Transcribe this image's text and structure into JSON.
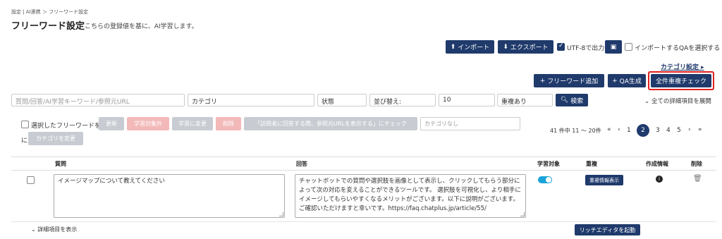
{
  "header": {
    "breadcrumb": "設定 | AI連携 ＞ フリーワード設定",
    "title": "フリーワード設定",
    "subtitle": "こちらの登録値を基に、AI学習します。"
  },
  "toolbar": {
    "import": "インポート",
    "export": "エクスポート",
    "utf8": "UTF-8で出力",
    "select_import_qa": "インポートするQAを選択する",
    "category_settings": "カテゴリ設定",
    "add_freeword": "フリーワード追加",
    "qa_generate": "QA生成",
    "dup_check": "全件重複チェック"
  },
  "filters": {
    "question_placeholder": "質問/回答/AI学習キーワード/参照元URL",
    "category": "カテゴリ",
    "status": "状態",
    "sort": "並び替え:",
    "per_page": "10",
    "duplicate": "重複あり",
    "search": "検索",
    "expand_all": "全ての詳細項目を展開"
  },
  "bulk": {
    "label_prefix": "選択したフリーワードを",
    "update": "更新",
    "exclude": "学習対象外",
    "include": "学習に変更",
    "delete": "削除",
    "check_url": "「訪問者に回答する際、参照元URLを表示する」にチェック",
    "category_none": "カテゴリなし",
    "label_ni": "に",
    "change_category": "カテゴリを変更"
  },
  "pagination": {
    "summary": "41 件中 11 〜 20件",
    "first": "«",
    "prev": "‹",
    "pages": [
      "1",
      "2",
      "3",
      "4",
      "5"
    ],
    "current": "2",
    "next": "›",
    "last": "»"
  },
  "table": {
    "headers": {
      "question": "質問",
      "answer": "回答",
      "learning": "学習対象",
      "duplicate": "重複",
      "created": "作成情報",
      "delete": "削除"
    },
    "row": {
      "question": "イメージマップについて教えてください",
      "answer": "チャットボットでの質問や選択肢を画像として表示し、クリックしてもらう部分によって次の対応を変えることができるツールです。 選択肢を可視化し、より相手にイメージしてもらいやすくなるメリットがございます。以下に説明がございます。ご確認いただけますと幸いです。https://faq.chatplus.jp/article/55/",
      "learning_on": true,
      "dup_button": "重複情報表示"
    },
    "show_details": "詳細項目を表示",
    "rich_editor": "リッチエディタを起動"
  },
  "colors": {
    "navy": "#1f3a6b",
    "highlight": "#e02020",
    "toggle": "#1aa3d8"
  }
}
